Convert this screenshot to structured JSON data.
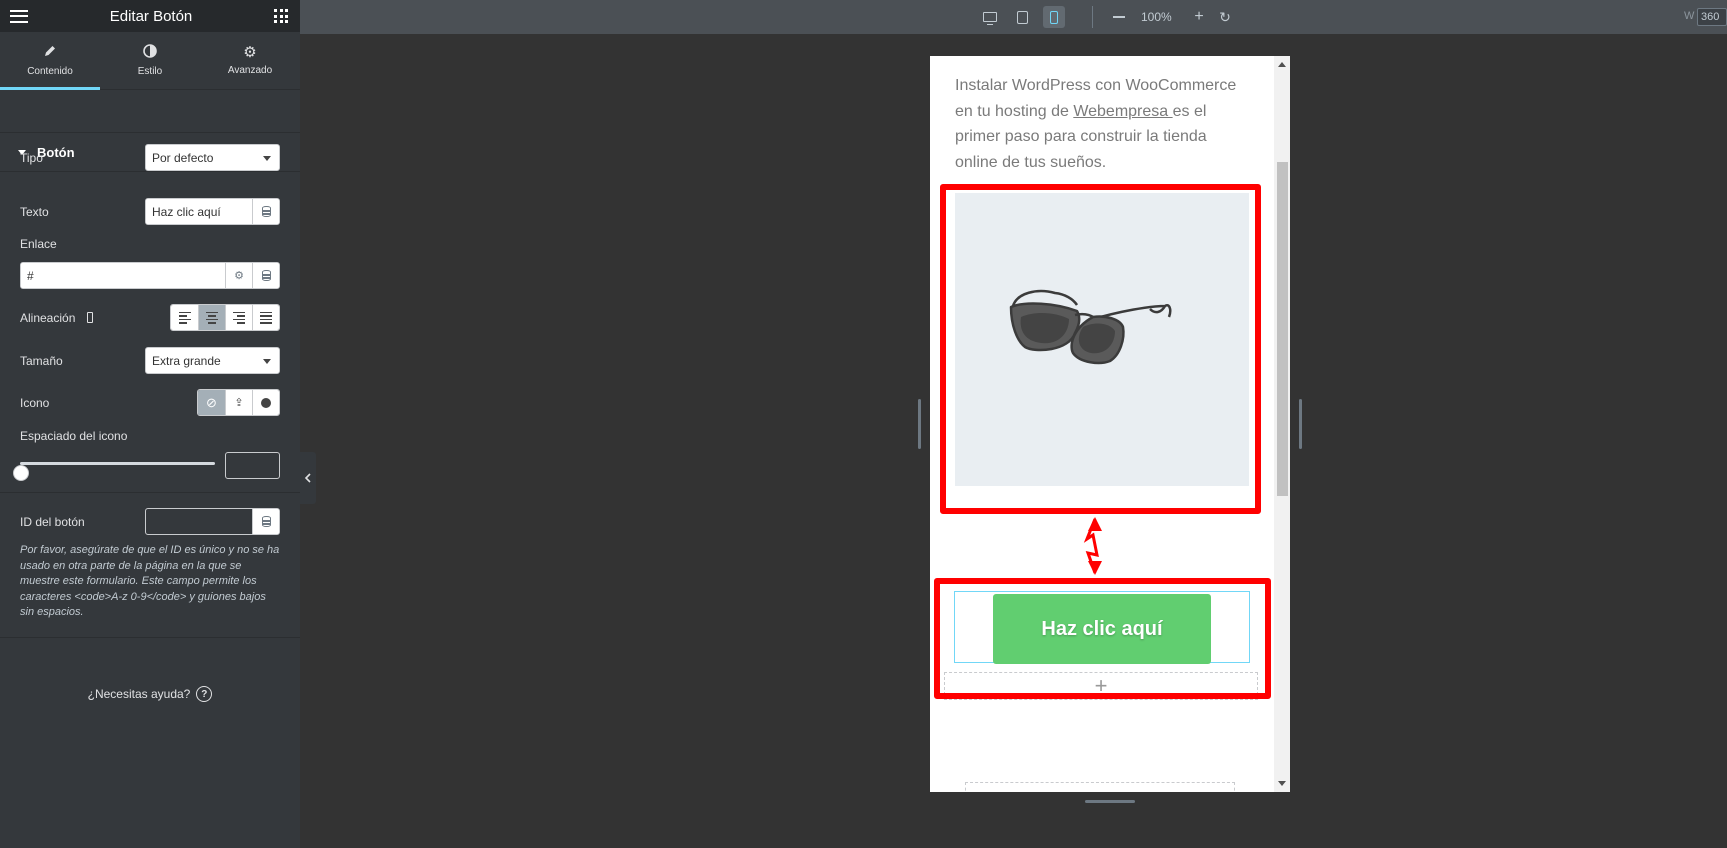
{
  "panel": {
    "title": "Editar Botón",
    "tabs": [
      {
        "label": "Contenido",
        "icon": "pencil-icon"
      },
      {
        "label": "Estilo",
        "icon": "contrast-icon"
      },
      {
        "label": "Avanzado",
        "icon": "gear-icon"
      }
    ],
    "section": "Botón",
    "fields": {
      "tipo": {
        "label": "Tipo",
        "value": "Por defecto"
      },
      "texto": {
        "label": "Texto",
        "value": "Haz clic aquí"
      },
      "enlace": {
        "label": "Enlace",
        "value": "#"
      },
      "alineacion": {
        "label": "Alineación",
        "selected": "center"
      },
      "tamano": {
        "label": "Tamaño",
        "value": "Extra grande"
      },
      "icono": {
        "label": "Icono"
      },
      "espaciado": {
        "label": "Espaciado del icono",
        "value": 0
      },
      "id_boton": {
        "label": "ID del botón",
        "value": ""
      }
    },
    "note": "Por favor, asegúrate de que el ID es único y no se ha usado en otra parte de la página en la que se muestre este formulario. Este campo permite los caracteres <code>A-z 0-9</code> y guiones bajos sin espacios.",
    "help": "¿Necesitas ayuda?",
    "help_icon": "?"
  },
  "topbar": {
    "zoom": "100%",
    "width_label": "W",
    "width_value": "360",
    "active_device": "mobile"
  },
  "preview": {
    "text_before_link": "Instalar WordPress con WooCommerce en tu hosting de ",
    "link_text": "Webempresa ",
    "text_after_link": "es el primer paso para construir la tienda online de tus sueños.",
    "image_alt": "sunglasses-image",
    "button_label": "Haz clic aquí",
    "button_color": "#61ce70",
    "add_icon": "+"
  },
  "annotation": {
    "color": "#ff0000"
  }
}
